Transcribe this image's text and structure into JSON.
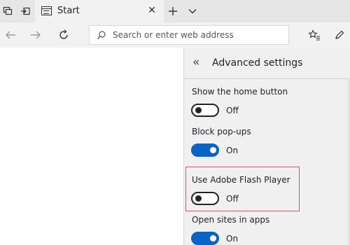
{
  "tab": {
    "title": "Start"
  },
  "address_bar": {
    "placeholder": "Search or enter web address"
  },
  "settings": {
    "title": "Advanced settings",
    "items": [
      {
        "label": "Show the home button",
        "state": "Off",
        "on": false
      },
      {
        "label": "Block pop-ups",
        "state": "On",
        "on": true
      },
      {
        "label": "Use Adobe Flash Player",
        "state": "Off",
        "on": false
      },
      {
        "label": "Open sites in apps",
        "state": "On",
        "on": true
      }
    ]
  },
  "colors": {
    "toggle_on": "#0a64c8",
    "highlight_border": "#d9535a",
    "panel_bg": "#f0f0f0"
  }
}
